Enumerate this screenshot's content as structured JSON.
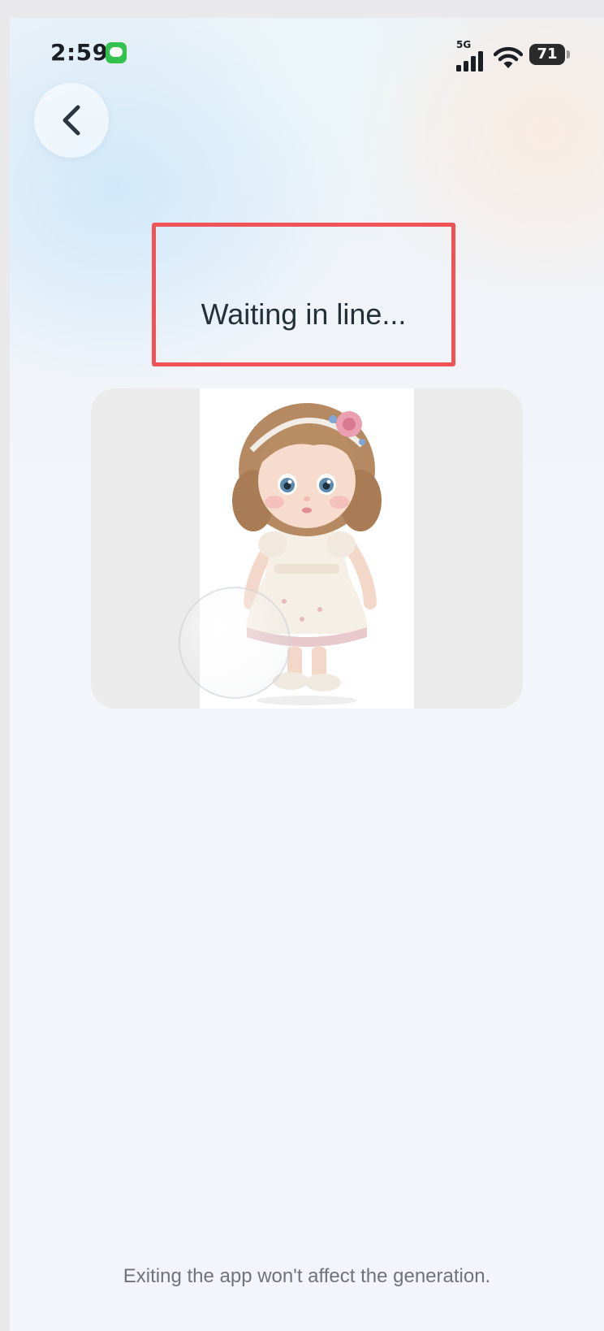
{
  "status_bar": {
    "time": "2:59",
    "network": "5G",
    "battery": "71",
    "icons": [
      "messages-icon",
      "signal-icon",
      "wifi-icon",
      "battery-icon"
    ]
  },
  "header": {
    "back_icon": "chevron-left-icon"
  },
  "main": {
    "title": "Waiting in line...",
    "preview_subject": "doll-image"
  },
  "footer": {
    "note": "Exiting the app won't affect the generation."
  },
  "colors": {
    "highlight_border": "#ef5356",
    "title_text": "#243038",
    "footer_text": "#6f737a",
    "background": "#f4f5fa"
  }
}
